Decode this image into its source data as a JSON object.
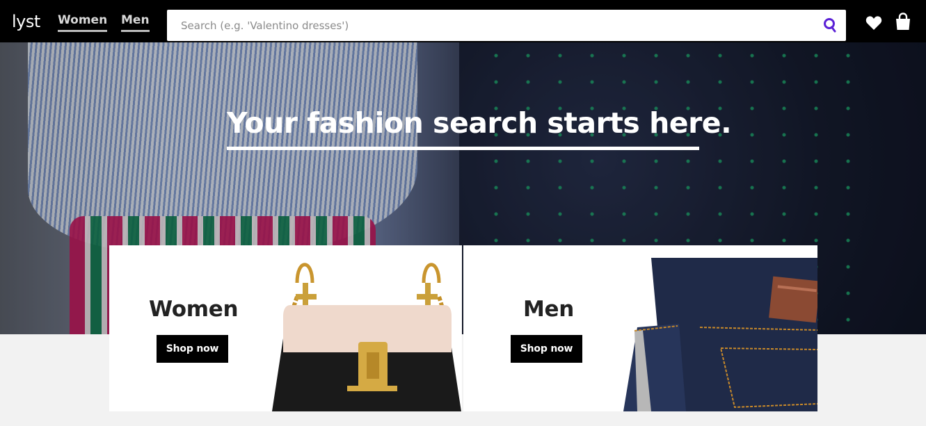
{
  "header": {
    "logo": "lyst",
    "nav": [
      {
        "label": "Women"
      },
      {
        "label": "Men"
      }
    ],
    "search": {
      "placeholder": "Search (e.g. 'Valentino dresses')",
      "value": ""
    },
    "icons": [
      "search-icon",
      "heart-icon",
      "shopping-bag-icon"
    ]
  },
  "hero": {
    "title": "Your fashion search starts here."
  },
  "categories": [
    {
      "title": "Women",
      "button_label": "Shop now",
      "image": "handbag-product"
    },
    {
      "title": "Men",
      "button_label": "Shop now",
      "image": "jeans-product"
    }
  ],
  "colors": {
    "header_bg": "#000000",
    "search_icon_accent": "#5b21d6",
    "button_bg": "#000000",
    "page_bg": "#f2f2f2"
  }
}
